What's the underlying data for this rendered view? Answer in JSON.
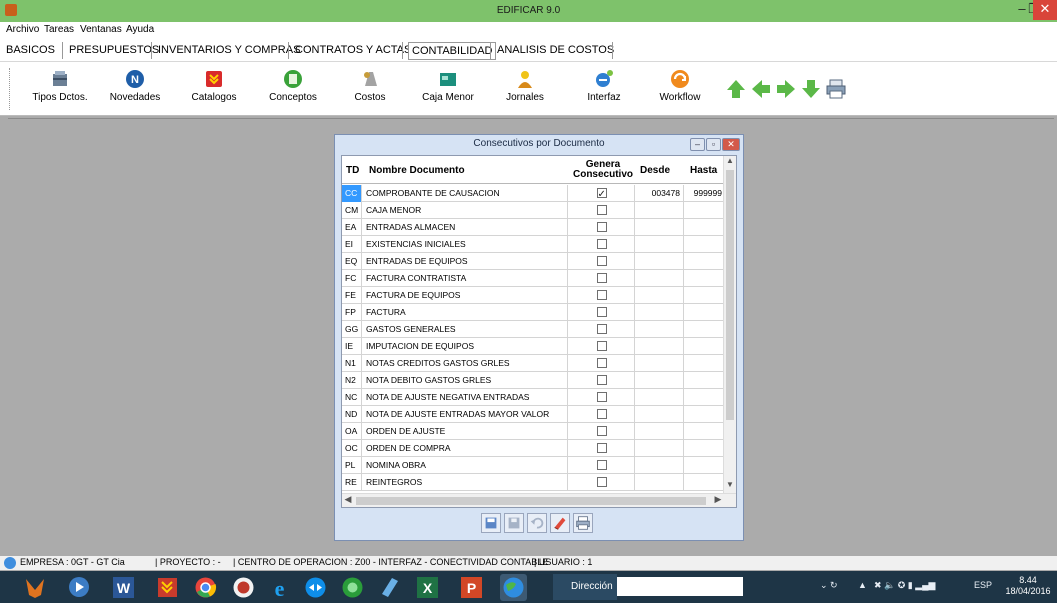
{
  "window": {
    "title": "EDIFICAR 9.0",
    "minimize": "–",
    "restore": "❐",
    "close": "✕"
  },
  "menu": [
    "Archivo",
    "Tareas",
    "Ventanas",
    "Ayuda"
  ],
  "modules": [
    "BASICOS",
    "PRESUPUESTOS",
    "INVENTARIOS Y COMPRAS",
    "CONTRATOS Y ACTAS",
    "CONTABILIDAD",
    "ANALISIS DE COSTOS"
  ],
  "active_module": "CONTABILIDAD",
  "toolbar": [
    "Tipos Dctos.",
    "Novedades",
    "Catalogos",
    "Conceptos",
    "Costos",
    "Caja Menor",
    "Jornales",
    "Interfaz",
    "Workflow"
  ],
  "dialog": {
    "title": "Consecutivos por Documento",
    "columns": {
      "td": "TD",
      "nombre": "Nombre Documento",
      "genera": "Genera Consecutivo",
      "desde": "Desde",
      "hasta": "Hasta"
    },
    "rows": [
      {
        "td": "CC",
        "nombre": "COMPROBANTE DE CAUSACION",
        "genera": true,
        "desde": "003478",
        "hasta": "999999"
      },
      {
        "td": "CM",
        "nombre": "CAJA MENOR",
        "genera": false,
        "desde": "",
        "hasta": ""
      },
      {
        "td": "EA",
        "nombre": "ENTRADAS ALMACEN",
        "genera": false,
        "desde": "",
        "hasta": ""
      },
      {
        "td": "EI",
        "nombre": "EXISTENCIAS INICIALES",
        "genera": false,
        "desde": "",
        "hasta": ""
      },
      {
        "td": "EQ",
        "nombre": "ENTRADAS DE EQUIPOS",
        "genera": false,
        "desde": "",
        "hasta": ""
      },
      {
        "td": "FC",
        "nombre": "FACTURA CONTRATISTA",
        "genera": false,
        "desde": "",
        "hasta": ""
      },
      {
        "td": "FE",
        "nombre": "FACTURA DE EQUIPOS",
        "genera": false,
        "desde": "",
        "hasta": ""
      },
      {
        "td": "FP",
        "nombre": "FACTURA",
        "genera": false,
        "desde": "",
        "hasta": ""
      },
      {
        "td": "GG",
        "nombre": "GASTOS GENERALES",
        "genera": false,
        "desde": "",
        "hasta": ""
      },
      {
        "td": "IE",
        "nombre": "IMPUTACION DE EQUIPOS",
        "genera": false,
        "desde": "",
        "hasta": ""
      },
      {
        "td": "N1",
        "nombre": "NOTAS CREDITOS GASTOS GRLES",
        "genera": false,
        "desde": "",
        "hasta": ""
      },
      {
        "td": "N2",
        "nombre": "NOTA DEBITO GASTOS GRLES",
        "genera": false,
        "desde": "",
        "hasta": ""
      },
      {
        "td": "NC",
        "nombre": "NOTA DE AJUSTE NEGATIVA ENTRADAS",
        "genera": false,
        "desde": "",
        "hasta": ""
      },
      {
        "td": "ND",
        "nombre": "NOTA DE AJUSTE ENTRADAS MAYOR VALOR",
        "genera": false,
        "desde": "",
        "hasta": ""
      },
      {
        "td": "OA",
        "nombre": "ORDEN DE AJUSTE",
        "genera": false,
        "desde": "",
        "hasta": ""
      },
      {
        "td": "OC",
        "nombre": "ORDEN DE COMPRA",
        "genera": false,
        "desde": "",
        "hasta": ""
      },
      {
        "td": "PL",
        "nombre": "NOMINA OBRA",
        "genera": false,
        "desde": "",
        "hasta": ""
      },
      {
        "td": "RE",
        "nombre": "REINTEGROS",
        "genera": false,
        "desde": "",
        "hasta": ""
      }
    ]
  },
  "status": {
    "empresa": "EMPRESA : 0GT - GT Cia",
    "proyecto": "| PROYECTO : -",
    "centro": "| CENTRO DE OPERACION : Z00 - INTERFAZ - CONECTIVIDAD CONTABLE",
    "usuario": "| USUARIO : 1"
  },
  "taskbar": {
    "address_label": "Dirección",
    "lang": "ESP",
    "time": "8.44",
    "date": "18/04/2016"
  }
}
